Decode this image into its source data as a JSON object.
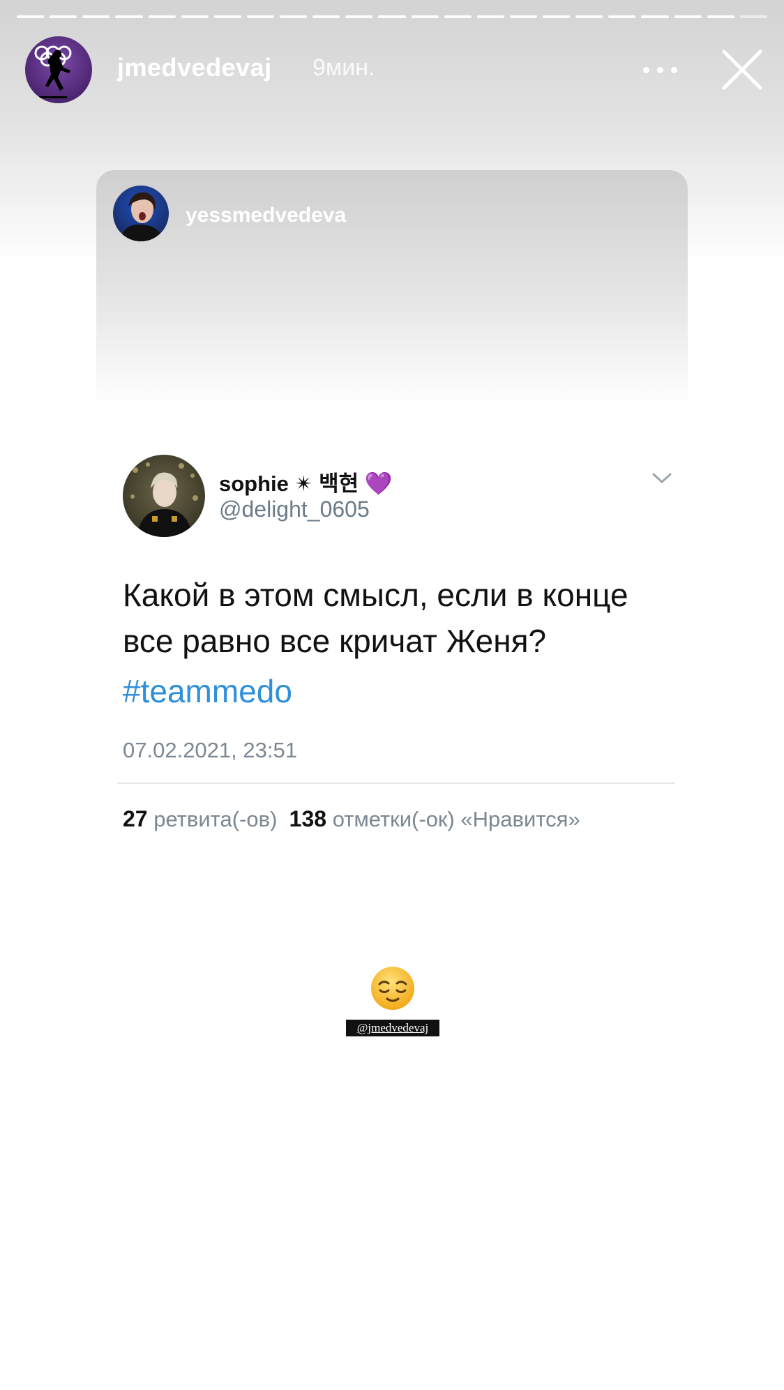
{
  "story": {
    "segments_total": 23,
    "segments_completed": 22,
    "header": {
      "username": "jmedvedevaj",
      "time_ago": "9мин."
    },
    "shared_post": {
      "username": "yessmedvedeva"
    },
    "tweet": {
      "display_name": "sophie ✴ 백현",
      "name_emoji": "💜",
      "handle": "@delight_0605",
      "text_line1": "Какой в этом смысл, если в конце",
      "text_line2": "все равно все кричат Женя?",
      "hashtag": "#teammedo",
      "datetime": "07.02.2021, 23:51",
      "retweets_count": "27",
      "retweets_label": "ретвита(-ов)",
      "likes_count": "138",
      "likes_label": "отметки(-ок) «Нравится»"
    },
    "sticker": {
      "emoji": "relieved-face",
      "mention": "@jmedvedevaj"
    }
  },
  "colors": {
    "hashtag": "#2f8fd9",
    "secondary_text": "#7b8792",
    "heart": "#9b59d0"
  }
}
